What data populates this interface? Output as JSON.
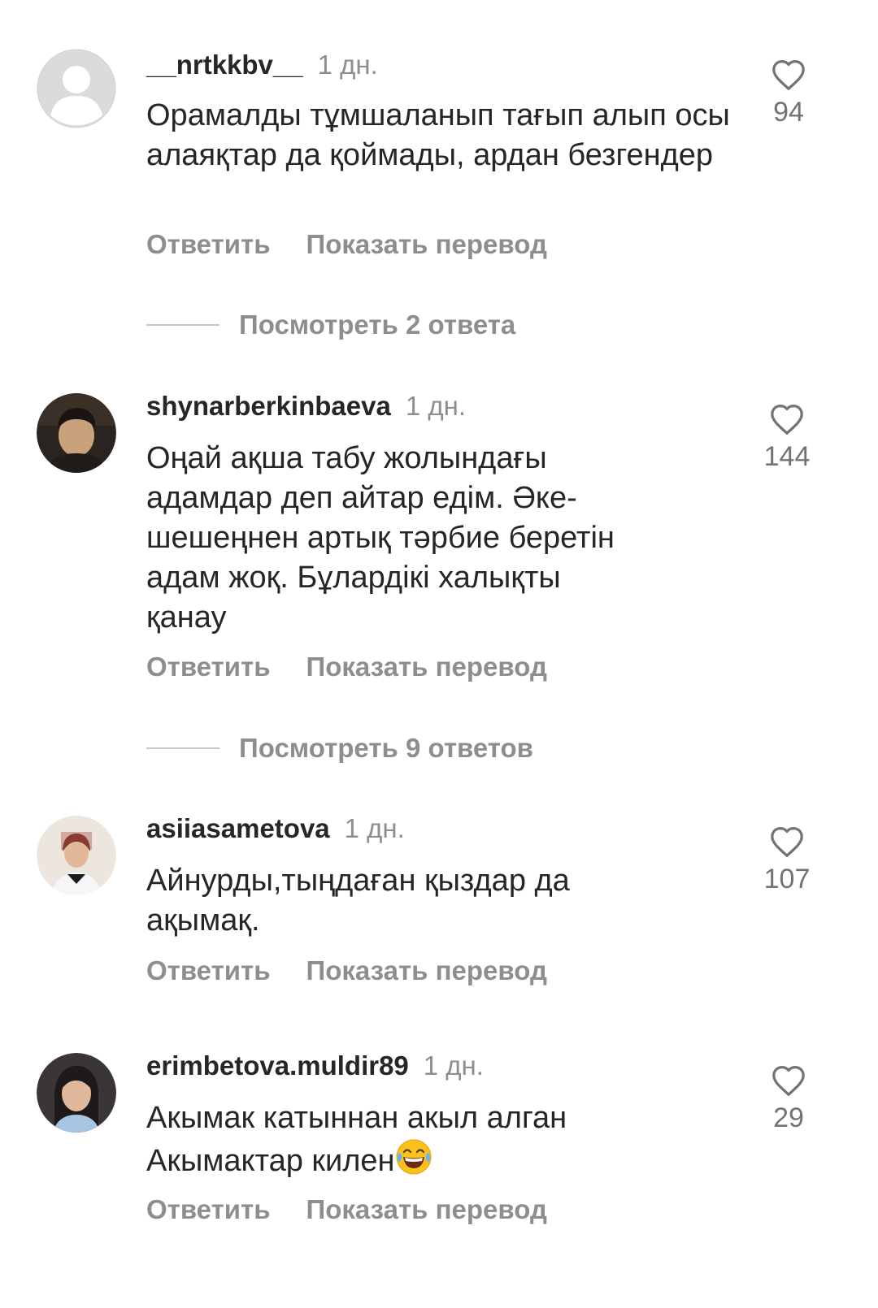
{
  "comments": [
    {
      "username": "__nrtkkbv__",
      "time": "1 дн.",
      "text": "Орамалды тұмшаланып  тағып алып осы алаяқтар да қоймады, ардан безгендер",
      "likes": "94",
      "reply_label": "Ответить",
      "translate_label": "Показать перевод",
      "view_replies": "Посмотреть 2 ответа"
    },
    {
      "username": "shynarberkinbaeva",
      "time": "1 дн.",
      "text": "Оңай ақша табу жолындағы адамдар деп айтар едім. Әке-шешеңнен артық тәрбие беретін адам жоқ. Бұлардікі халықты қанау",
      "likes": "144",
      "reply_label": "Ответить",
      "translate_label": "Показать перевод",
      "view_replies": "Посмотреть 9 ответов"
    },
    {
      "username": "asiiasametova",
      "time": "1 дн.",
      "text": "Айнурды,тыңдаған  қыздар да ақымақ.",
      "likes": "107",
      "reply_label": "Ответить",
      "translate_label": "Показать перевод"
    },
    {
      "username": "erimbetova.muldir89",
      "time": "1 дн.",
      "text": "Акымак катыннан акыл алган Акымактар килен",
      "emoji": "grinning-with-tears-emoji",
      "likes": "29",
      "reply_label": "Ответить",
      "translate_label": "Показать перевод"
    }
  ],
  "icons": {
    "like": "heart-outline-icon",
    "default_avatar": "default-profile-icon"
  },
  "colors": {
    "primary_text": "#262626",
    "secondary_text": "#8e8e8e",
    "divider": "#c7c7c7",
    "avatar_placeholder": "#dbdbdb"
  }
}
